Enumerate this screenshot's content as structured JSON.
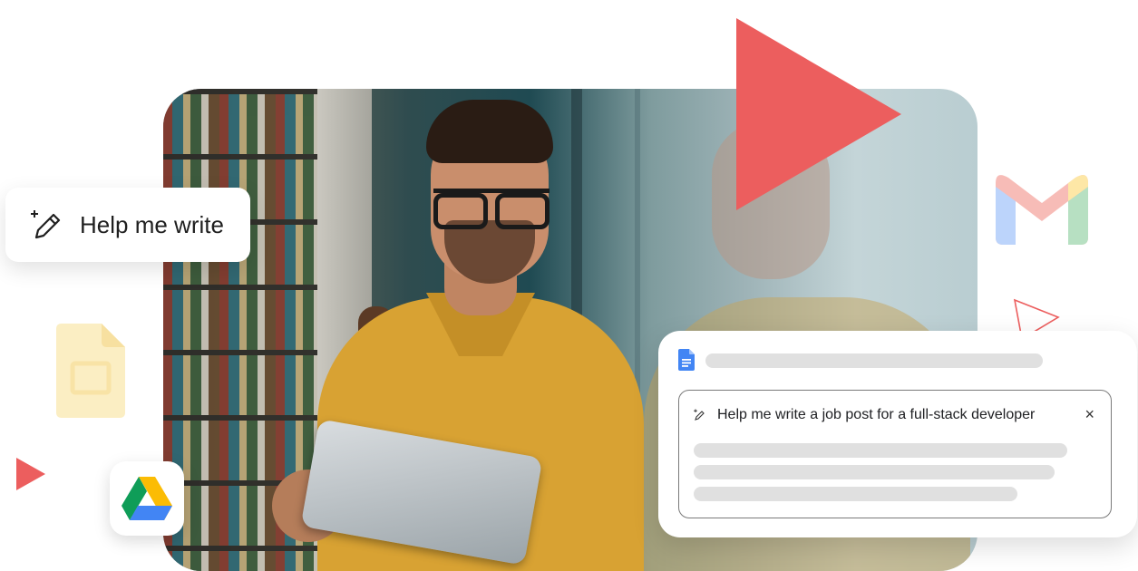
{
  "help_card": {
    "label": "Help me write"
  },
  "doc_card": {
    "prompt": "Help me write a job post for a full-stack developer",
    "close_symbol": "×"
  },
  "icons": [
    "pencil-sparkle-icon",
    "google-slides-icon",
    "gmail-icon",
    "google-drive-icon",
    "google-docs-icon",
    "play-icon"
  ],
  "colors": {
    "accent_red": "#ec5e5e",
    "placeholder_bar": "#e0e0e0"
  }
}
